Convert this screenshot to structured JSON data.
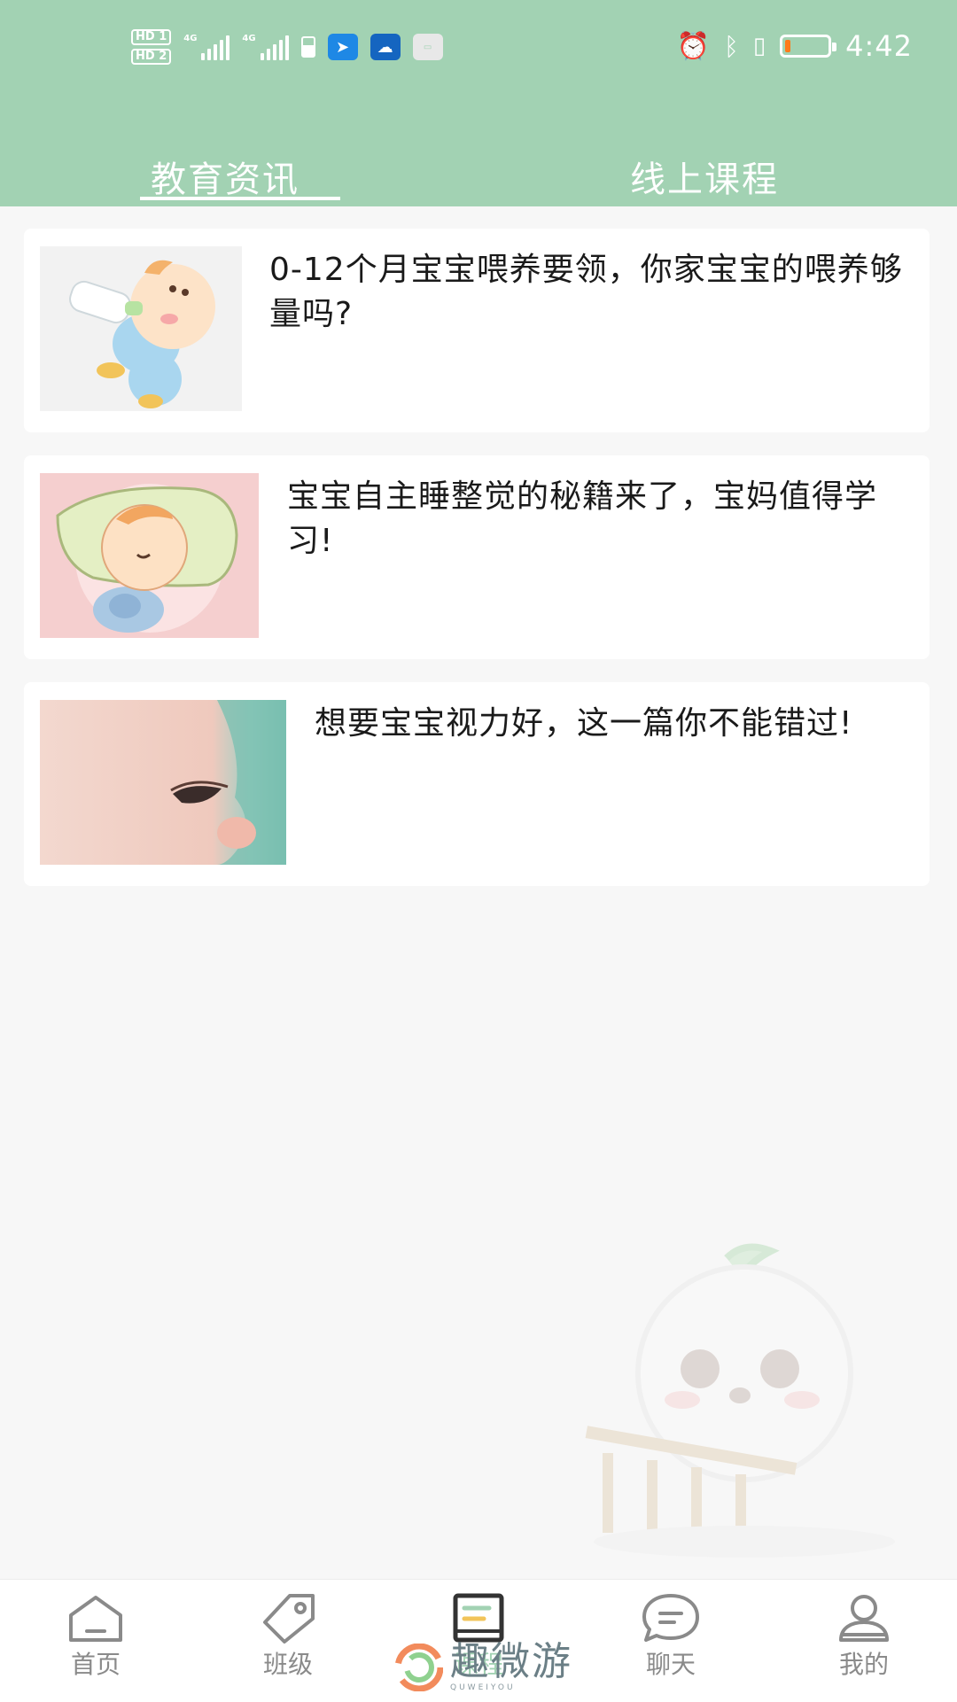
{
  "colors": {
    "accent": "#a2d2b3",
    "card_bg": "#ffffff",
    "page_bg": "#f7f7f7",
    "battery_fill": "#ff7a1a"
  },
  "status_bar": {
    "hd1": "HD 1",
    "hd2": "HD 2",
    "net1": "4G",
    "net2": "4G",
    "time": "4:42",
    "battery_level": 0.12,
    "icons": [
      "signal-icon",
      "signal-icon",
      "sim-icon",
      "app-icon",
      "weather-icon",
      "nfc-icon",
      "alarm-icon",
      "bluetooth-icon",
      "vibrate-icon",
      "battery-icon"
    ]
  },
  "tabs": [
    {
      "label": "教育资讯",
      "selected": true
    },
    {
      "label": "线上课程",
      "selected": false
    }
  ],
  "articles": [
    {
      "title": "0-12个月宝宝喂养要领，你家宝宝的喂养够量吗?",
      "thumbnail": "baby-bottle-illustration"
    },
    {
      "title": "宝宝自主睡整觉的秘籍来了，宝妈值得学习!",
      "thumbnail": "sleeping-baby-illustration"
    },
    {
      "title": "想要宝宝视力好，这一篇你不能错过!",
      "thumbnail": "baby-eye-photo"
    }
  ],
  "bottom_nav": [
    {
      "label": "首页",
      "icon": "home-icon",
      "selected": false
    },
    {
      "label": "班级",
      "icon": "tag-icon",
      "selected": false
    },
    {
      "label": "课程",
      "icon": "book-icon",
      "selected": true
    },
    {
      "label": "聊天",
      "icon": "chat-icon",
      "selected": false
    },
    {
      "label": "我的",
      "icon": "profile-icon",
      "selected": false
    }
  ],
  "watermark": {
    "text": "趣微游",
    "sub": "QUWEIYOU"
  }
}
